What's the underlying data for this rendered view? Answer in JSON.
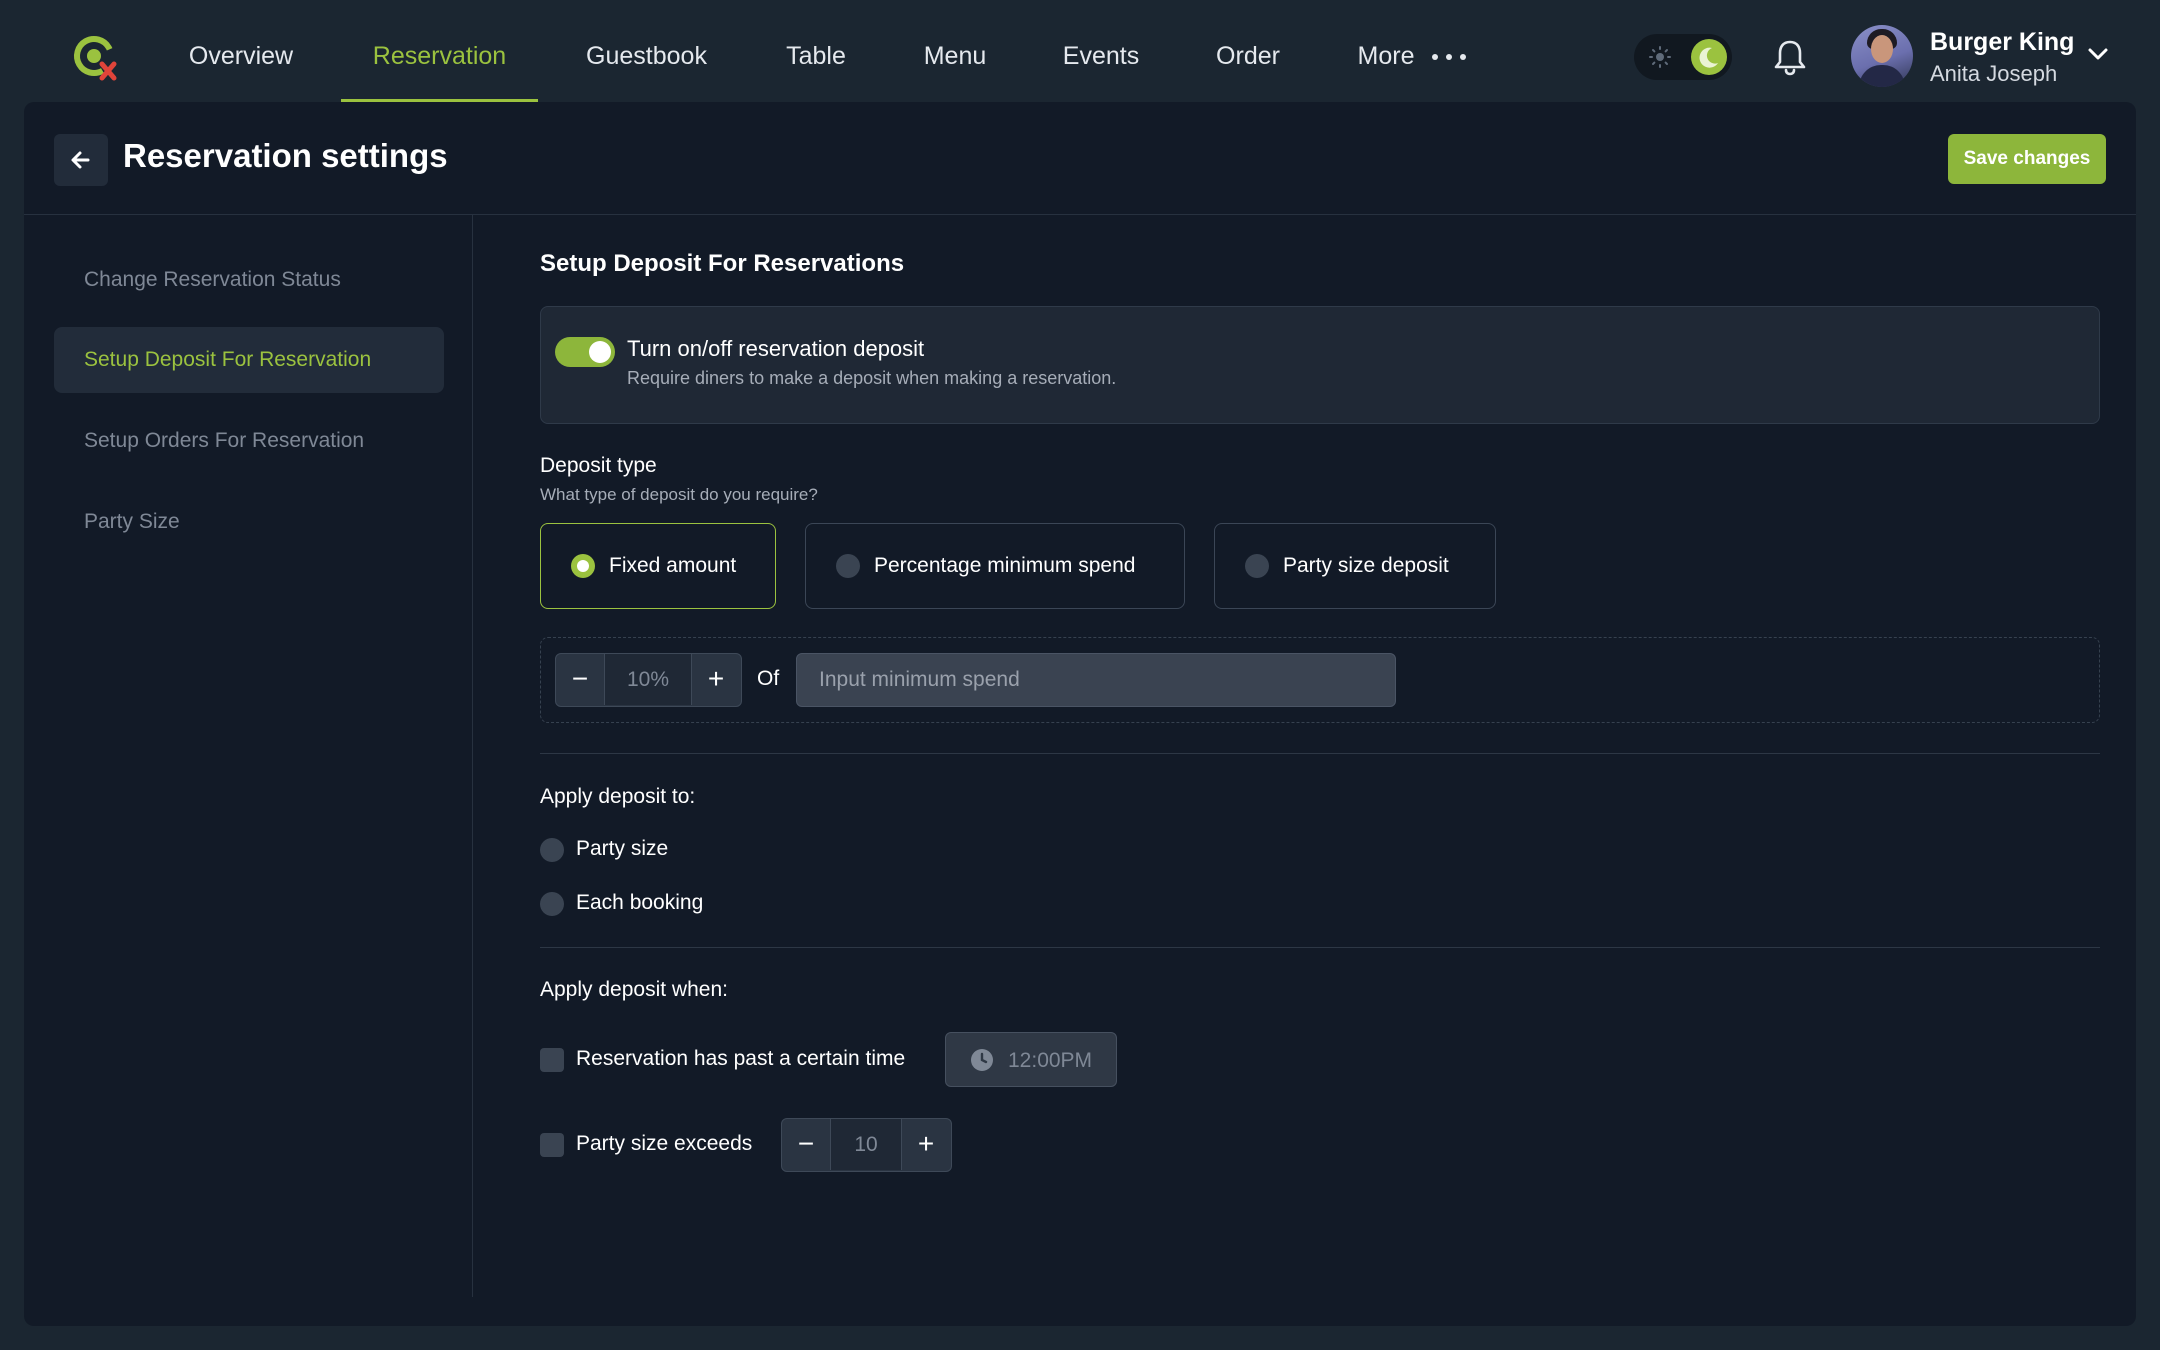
{
  "nav": {
    "items": [
      {
        "label": "Overview",
        "active": false
      },
      {
        "label": "Reservation",
        "active": true
      },
      {
        "label": "Guestbook",
        "active": false
      },
      {
        "label": "Table",
        "active": false
      },
      {
        "label": "Menu",
        "active": false
      },
      {
        "label": "Events",
        "active": false
      },
      {
        "label": "Order",
        "active": false
      },
      {
        "label": "More",
        "active": false
      }
    ],
    "accent_color": "#9bc23f",
    "theme": "dark"
  },
  "user": {
    "company": "Burger King",
    "name": "Anita Joseph"
  },
  "header": {
    "title": "Reservation settings",
    "save_label": "Save changes"
  },
  "sidebar": {
    "items": [
      {
        "label": "Change Reservation Status",
        "active": false
      },
      {
        "label": "Setup Deposit For Reservation",
        "active": true
      },
      {
        "label": "Setup Orders For Reservation",
        "active": false
      },
      {
        "label": "Party Size",
        "active": false
      }
    ]
  },
  "content": {
    "section_title": "Setup Deposit For Reservations",
    "deposit_toggle": {
      "label": "Turn on/off reservation deposit",
      "description": "Require diners to make a deposit when making a reservation.",
      "on": true
    },
    "deposit_type": {
      "label": "Deposit type",
      "hint": "What type of deposit do you require?",
      "options": [
        {
          "label": "Fixed amount",
          "selected": true
        },
        {
          "label": "Percentage minimum spend",
          "selected": false
        },
        {
          "label": "Party size deposit",
          "selected": false
        }
      ]
    },
    "percentage": {
      "decrement": "−",
      "value": "10%",
      "increment": "+",
      "of_label": "Of",
      "spend_placeholder": "Input minimum spend"
    },
    "apply_to": {
      "label": "Apply deposit to:",
      "options": [
        {
          "label": "Party size",
          "selected": false
        },
        {
          "label": "Each booking",
          "selected": false
        }
      ]
    },
    "apply_when": {
      "label": "Apply deposit when:",
      "time_condition": {
        "label": "Reservation has past a certain time",
        "checked": false,
        "time": "12:00PM"
      },
      "party_condition": {
        "label": "Party size exceeds",
        "checked": false,
        "decrement": "−",
        "value": "10",
        "increment": "+"
      }
    }
  }
}
